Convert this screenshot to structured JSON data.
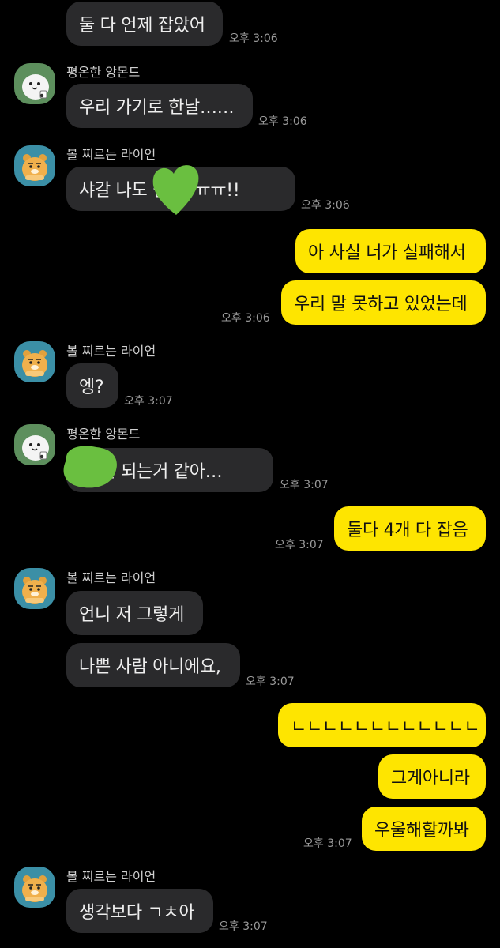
{
  "colors": {
    "background": "#000000",
    "incoming_bubble": "#2a2a2c",
    "outgoing_bubble": "#fee500",
    "time_text": "#9a9a9a",
    "redaction_mark": "#6abf40"
  },
  "senders": {
    "apeach": "평온한 앙몬드",
    "ryan": "볼 찌르는 라이언"
  },
  "messages": [
    {
      "text": "둘 다 언제 잡았어",
      "time": "오후 3:06"
    },
    {
      "text": "우리 가기로 한날……",
      "time": "오후 3:06"
    },
    {
      "text": "샤갈 나도     갈 걸 ㅠㅠ!!",
      "time": "오후 3:06"
    },
    {
      "text": "아 사실 너가 실패해서"
    },
    {
      "text": "우리 말 못하고 있었는데",
      "time": "오후 3:06"
    },
    {
      "text": "엥?",
      "time": "오후 3:07"
    },
    {
      "text": "    이 잘 되는거 같아…",
      "time": "오후 3:07"
    },
    {
      "text": "둘다 4개 다 잡음",
      "time": "오후 3:07"
    },
    {
      "text": "언니 저 그렇게"
    },
    {
      "text": "나쁜 사람 아니에요,",
      "time": "오후 3:07"
    },
    {
      "text": "ㄴㄴㄴㄴㄴㄴㄴㄴㄴㄴㄴㄴ"
    },
    {
      "text": "그게아니라"
    },
    {
      "text": "우울해할까봐",
      "time": "오후 3:07"
    },
    {
      "text": "생각보다 ㄱㅊ아",
      "time": "오후 3:07"
    }
  ],
  "avatars": {
    "apeach": "peach-character-avatar",
    "ryan": "lion-character-avatar"
  }
}
